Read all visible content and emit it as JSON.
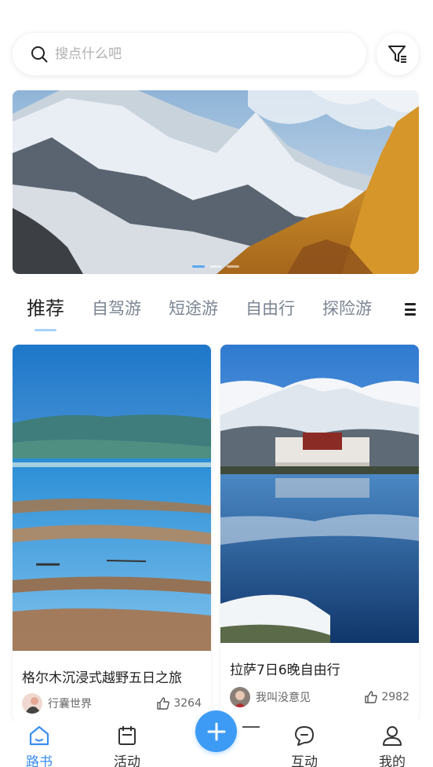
{
  "search": {
    "placeholder": "搜点什么吧"
  },
  "banner": {
    "dots": 3,
    "active_dot": 1
  },
  "tabs": [
    {
      "label": "推荐",
      "active": true
    },
    {
      "label": "自驾游",
      "active": false
    },
    {
      "label": "短途游",
      "active": false
    },
    {
      "label": "自由行",
      "active": false
    },
    {
      "label": "探险游",
      "active": false
    }
  ],
  "cards": [
    {
      "title": "格尔木沉浸式越野五日之旅",
      "author": "行囊世界",
      "likes": "3264"
    },
    {
      "title": "拉萨7日6晚自由行",
      "author": "我叫没意见",
      "likes": "2982"
    }
  ],
  "nav": {
    "items": [
      {
        "label": "路书",
        "icon": "home-icon",
        "active": true
      },
      {
        "label": "活动",
        "icon": "calendar-icon",
        "active": false
      },
      {
        "label": "互动",
        "icon": "chat-icon",
        "active": false
      },
      {
        "label": "我的",
        "icon": "user-icon",
        "active": false
      }
    ],
    "fab_icon": "plus-icon"
  },
  "colors": {
    "accent": "#3d9bf5",
    "tab_underline": "#a8d2ff",
    "muted_text": "#7b8593"
  }
}
